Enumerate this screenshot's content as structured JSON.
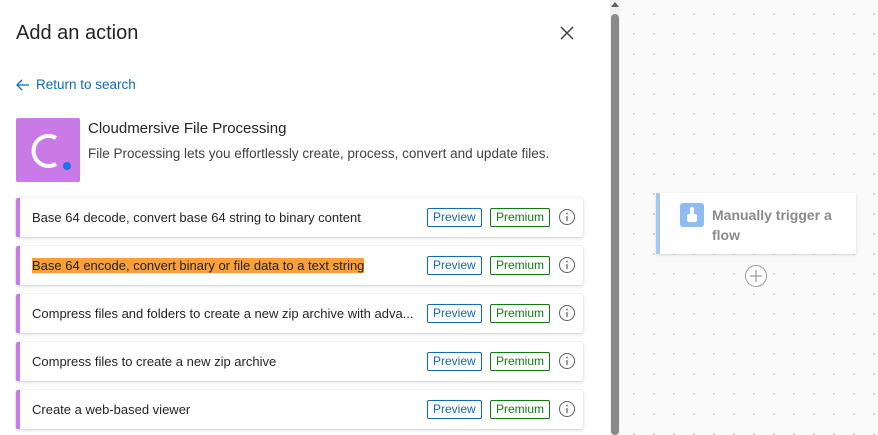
{
  "panel": {
    "title": "Add an action",
    "close_icon": "close-icon",
    "return_label": "Return to search"
  },
  "connector": {
    "name": "Cloudmersive File Processing",
    "description": "File Processing lets you effortlessly create, process, convert and update files.",
    "logo_color": "#c97ae6"
  },
  "badges": {
    "preview": "Preview",
    "premium": "Premium"
  },
  "actions": [
    {
      "label": "Base 64 decode, convert base 64 string to binary content"
    },
    {
      "label": "Base 64 encode, convert binary or file data to a text string"
    },
    {
      "label": "Compress files and folders to create a new zip archive with adva..."
    },
    {
      "label": "Compress files to create a new zip archive"
    },
    {
      "label": "Create a web-based viewer"
    }
  ],
  "canvas": {
    "trigger_label": "Manually trigger a flow"
  },
  "colors": {
    "accent": "#0f6cbd",
    "premium": "#107c10",
    "highlight": "#f7a03c"
  }
}
